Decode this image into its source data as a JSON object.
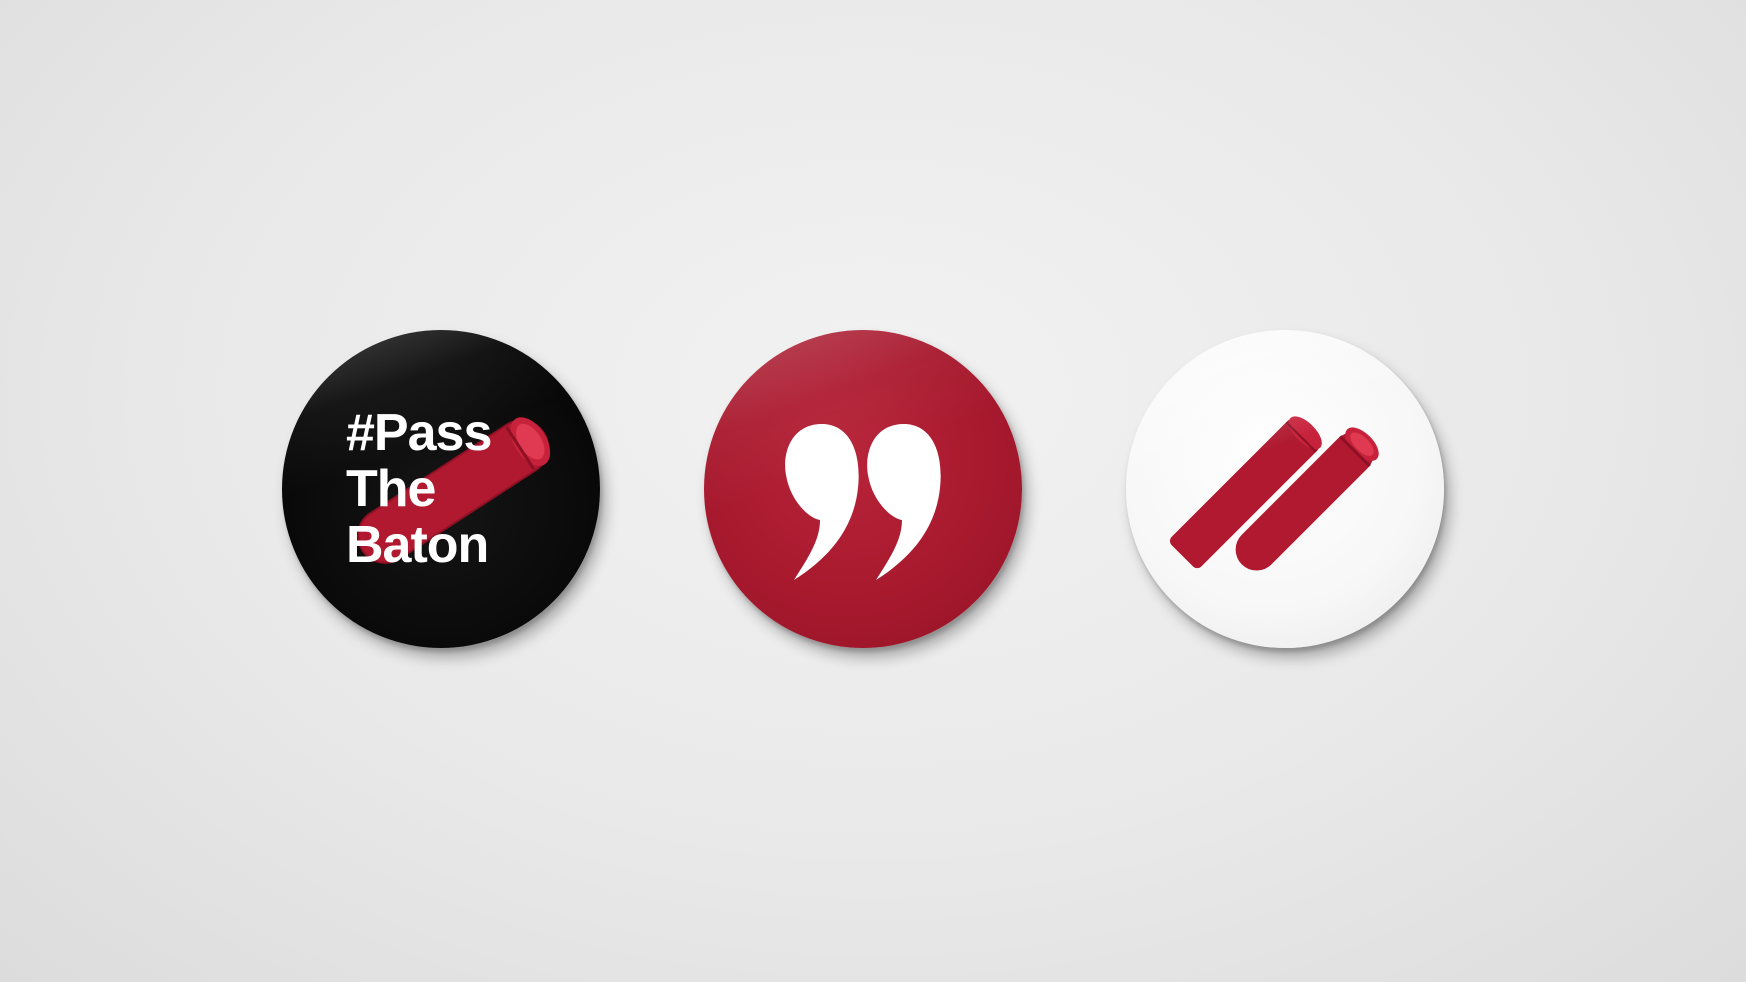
{
  "badges": [
    {
      "name": "pass-the-baton-badge",
      "background": "#000000",
      "text_lines": [
        "#Pass",
        "The",
        "Baton"
      ],
      "text_color": "#ffffff",
      "icon": "baton-icon",
      "icon_color": "#b0192f"
    },
    {
      "name": "quote-marks-badge",
      "background": "#a8192e",
      "icon": "quotation-marks-icon",
      "icon_color": "#ffffff"
    },
    {
      "name": "double-baton-badge",
      "background": "#ffffff",
      "icon": "double-baton-icon",
      "icon_color": "#b0192f"
    }
  ],
  "colors": {
    "background": "#e9e9e9",
    "accent_red": "#a8192e",
    "black": "#000000",
    "white": "#ffffff"
  }
}
